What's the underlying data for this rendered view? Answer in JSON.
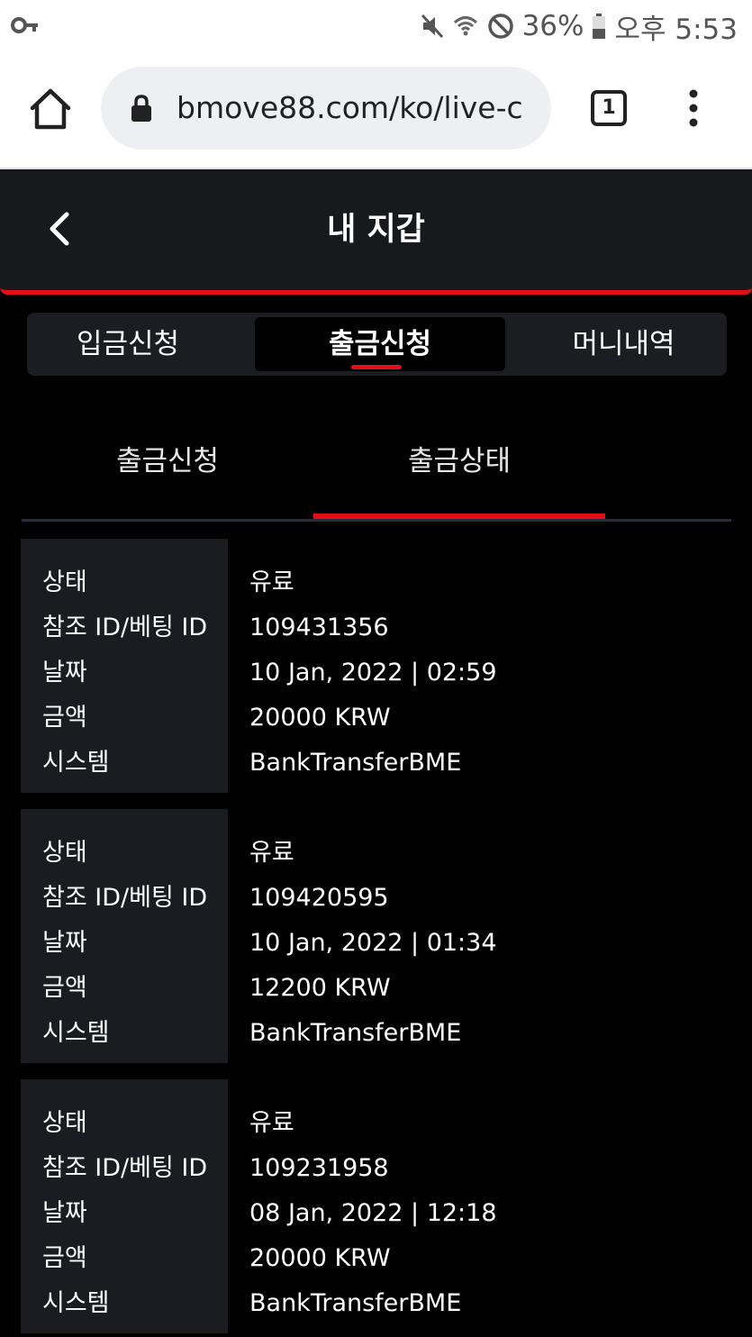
{
  "status_bar": {
    "battery_percent": "36%",
    "time": "오후 5:53",
    "icons": [
      "key-icon",
      "mute-icon",
      "wifi-icon",
      "do-not-disturb-icon",
      "battery-icon"
    ]
  },
  "browser": {
    "url": "bmove88.com/ko/live-c",
    "tab_count": "1"
  },
  "header": {
    "title": "내 지갑"
  },
  "main_tabs": [
    {
      "label": "입금신청",
      "active": false
    },
    {
      "label": "출금신청",
      "active": true
    },
    {
      "label": "머니내역",
      "active": false
    }
  ],
  "sub_tabs": [
    {
      "label": "출금신청",
      "active": false
    },
    {
      "label": "출금상태",
      "active": true
    }
  ],
  "labels": {
    "status": "상태",
    "reference": "참조 ID/베팅 ID",
    "date": "날짜",
    "amount": "금액",
    "system": "시스템"
  },
  "records": [
    {
      "status": "유료",
      "reference": "109431356",
      "date": "10 Jan, 2022 | 02:59",
      "amount": "20000 KRW",
      "system": "BankTransferBME"
    },
    {
      "status": "유료",
      "reference": "109420595",
      "date": "10 Jan, 2022 | 01:34",
      "amount": "12200 KRW",
      "system": "BankTransferBME"
    },
    {
      "status": "유료",
      "reference": "109231958",
      "date": "08 Jan, 2022 | 12:18",
      "amount": "20000 KRW",
      "system": "BankTransferBME"
    }
  ],
  "colors": {
    "accent": "#e40e18",
    "header_bg": "#18191d",
    "panel_bg": "#1b1c21",
    "page_bg": "#000000"
  }
}
